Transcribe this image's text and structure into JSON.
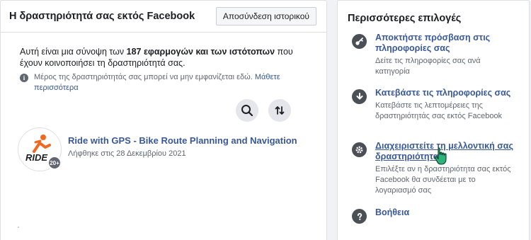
{
  "left": {
    "title": "Η δραστηριότητά σας εκτός Facebook",
    "clear_history_label": "Αποσύνδεση ιστορικού",
    "summary_prefix": "Αυτή είναι μια σύνοψη των",
    "summary_bold": "187 εφαρμογών και των ιστότοπων",
    "summary_suffix": "που έχουν κοινοποιήσει τη δραστηριότητά σας.",
    "info_text": "Μέρος της δραστηριότητάς σας μπορεί να μην εμφανίζεται εδώ.",
    "info_link": "Μάθετε περισσότερα",
    "app": {
      "logo_text": "RIDE",
      "badge": "20+",
      "name": "Ride with GPS - Bike Route Planning and Navigation",
      "date": "Λήφθηκε στις 28 Δεκεμβρίου 2021"
    }
  },
  "right": {
    "title": "Περισσότερες επιλογές",
    "options": [
      {
        "title": "Αποκτήστε πρόσβαση στις πληροφορίες σας",
        "desc": "Δείτε τις πληροφορίες σας ανά κατηγορία",
        "icon": "key-icon"
      },
      {
        "title": "Κατεβάστε τις πληροφορίες σας",
        "desc": "Κατεβάστε τις λεπτομέρειες της δραστηριότητάς σας εκτός Facebook",
        "icon": "download-icon"
      },
      {
        "title": "Διαχειριστείτε τη μελλοντική σας δραστηριότητα",
        "desc": "Επιλέξτε αν η δραστηριότητα σας εκτός Facebook θα συνδέεται με το λογαριασμό σας",
        "icon": "gear-icon"
      },
      {
        "title": "Βοήθεια",
        "desc": "",
        "icon": "question-icon"
      }
    ]
  },
  "colors": {
    "link": "#385898",
    "icon_bg": "#4b4f56",
    "page_bg": "#f0f2f5",
    "logo_orange": "#f26722"
  }
}
